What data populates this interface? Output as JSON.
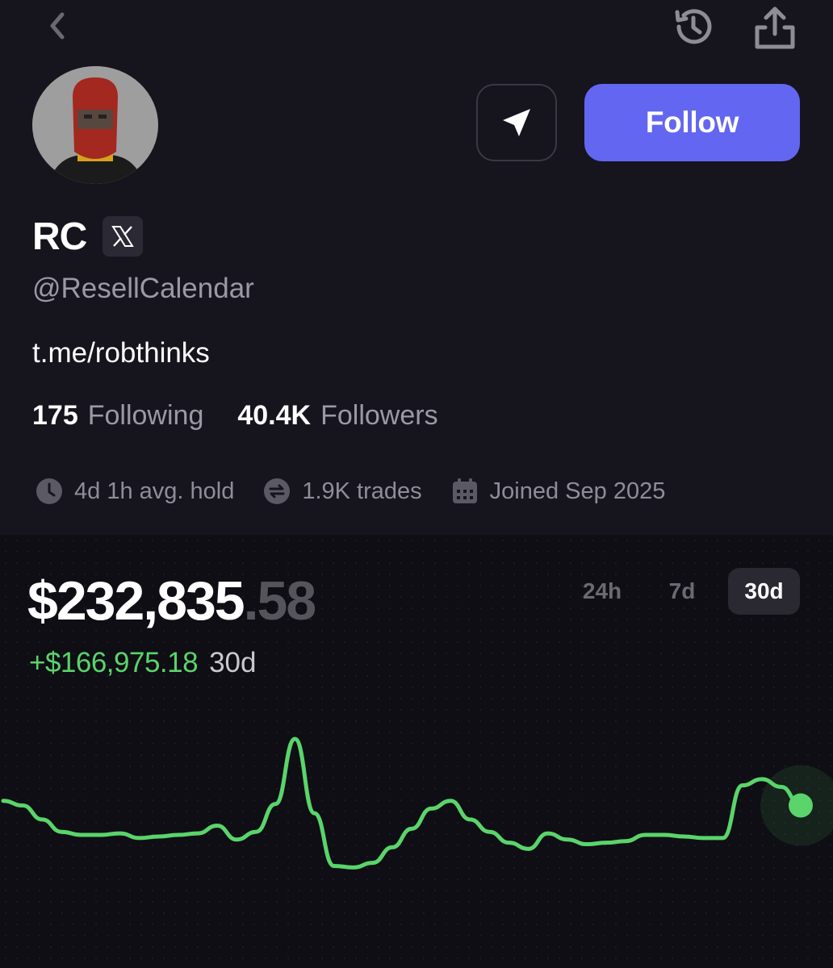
{
  "header": {
    "back_icon": "chevron-left-icon",
    "history_icon": "history-icon",
    "share_icon": "share-icon"
  },
  "profile": {
    "name": "RC",
    "badge_icon": "x-logo-icon",
    "handle": "@ResellCalendar",
    "bio": "t.me/robthinks",
    "following_count": "175",
    "following_label": "Following",
    "followers_count": "40.4K",
    "followers_label": "Followers",
    "follow_label": "Follow",
    "send_icon": "paper-plane-icon"
  },
  "meta": [
    {
      "icon": "clock-icon",
      "text": "4d 1h avg. hold"
    },
    {
      "icon": "swap-icon",
      "text": "1.9K trades"
    },
    {
      "icon": "calendar-icon",
      "text": "Joined Sep 2025"
    }
  ],
  "portfolio": {
    "balance_main": "$232,835",
    "balance_cents": ".58",
    "change_amount": "+$166,975.18",
    "change_period": "30d",
    "ranges": [
      "24h",
      "7d",
      "30d"
    ],
    "selected_range": "30d"
  },
  "colors": {
    "accent": "#6366f0",
    "positive": "#5ad46b",
    "background": "#16141d"
  },
  "chart_data": {
    "type": "line",
    "x": [
      0,
      1,
      2,
      3,
      4,
      5,
      6,
      7,
      8,
      9,
      10,
      11,
      12,
      13,
      14,
      15,
      16,
      17,
      18,
      19,
      20,
      21,
      22,
      23,
      24,
      25,
      26,
      27,
      28,
      29,
      30,
      31,
      32,
      33,
      34,
      35,
      36,
      37,
      38,
      39,
      40,
      41,
      42,
      43,
      44,
      45,
      46,
      47,
      48,
      49,
      50
    ],
    "series": [
      {
        "values": [
          0.6,
          0.57,
          0.48,
          0.4,
          0.38,
          0.38,
          0.39,
          0.36,
          0.37,
          0.38,
          0.39,
          0.44,
          0.35,
          0.4,
          0.58,
          1.0,
          0.52,
          0.18,
          0.17,
          0.2,
          0.3,
          0.42,
          0.55,
          0.6,
          0.48,
          0.4,
          0.33,
          0.29,
          0.39,
          0.35,
          0.32,
          0.33,
          0.34,
          0.38,
          0.38,
          0.37,
          0.36,
          0.36,
          0.7,
          0.74,
          0.69,
          0.57
        ]
      }
    ]
  }
}
